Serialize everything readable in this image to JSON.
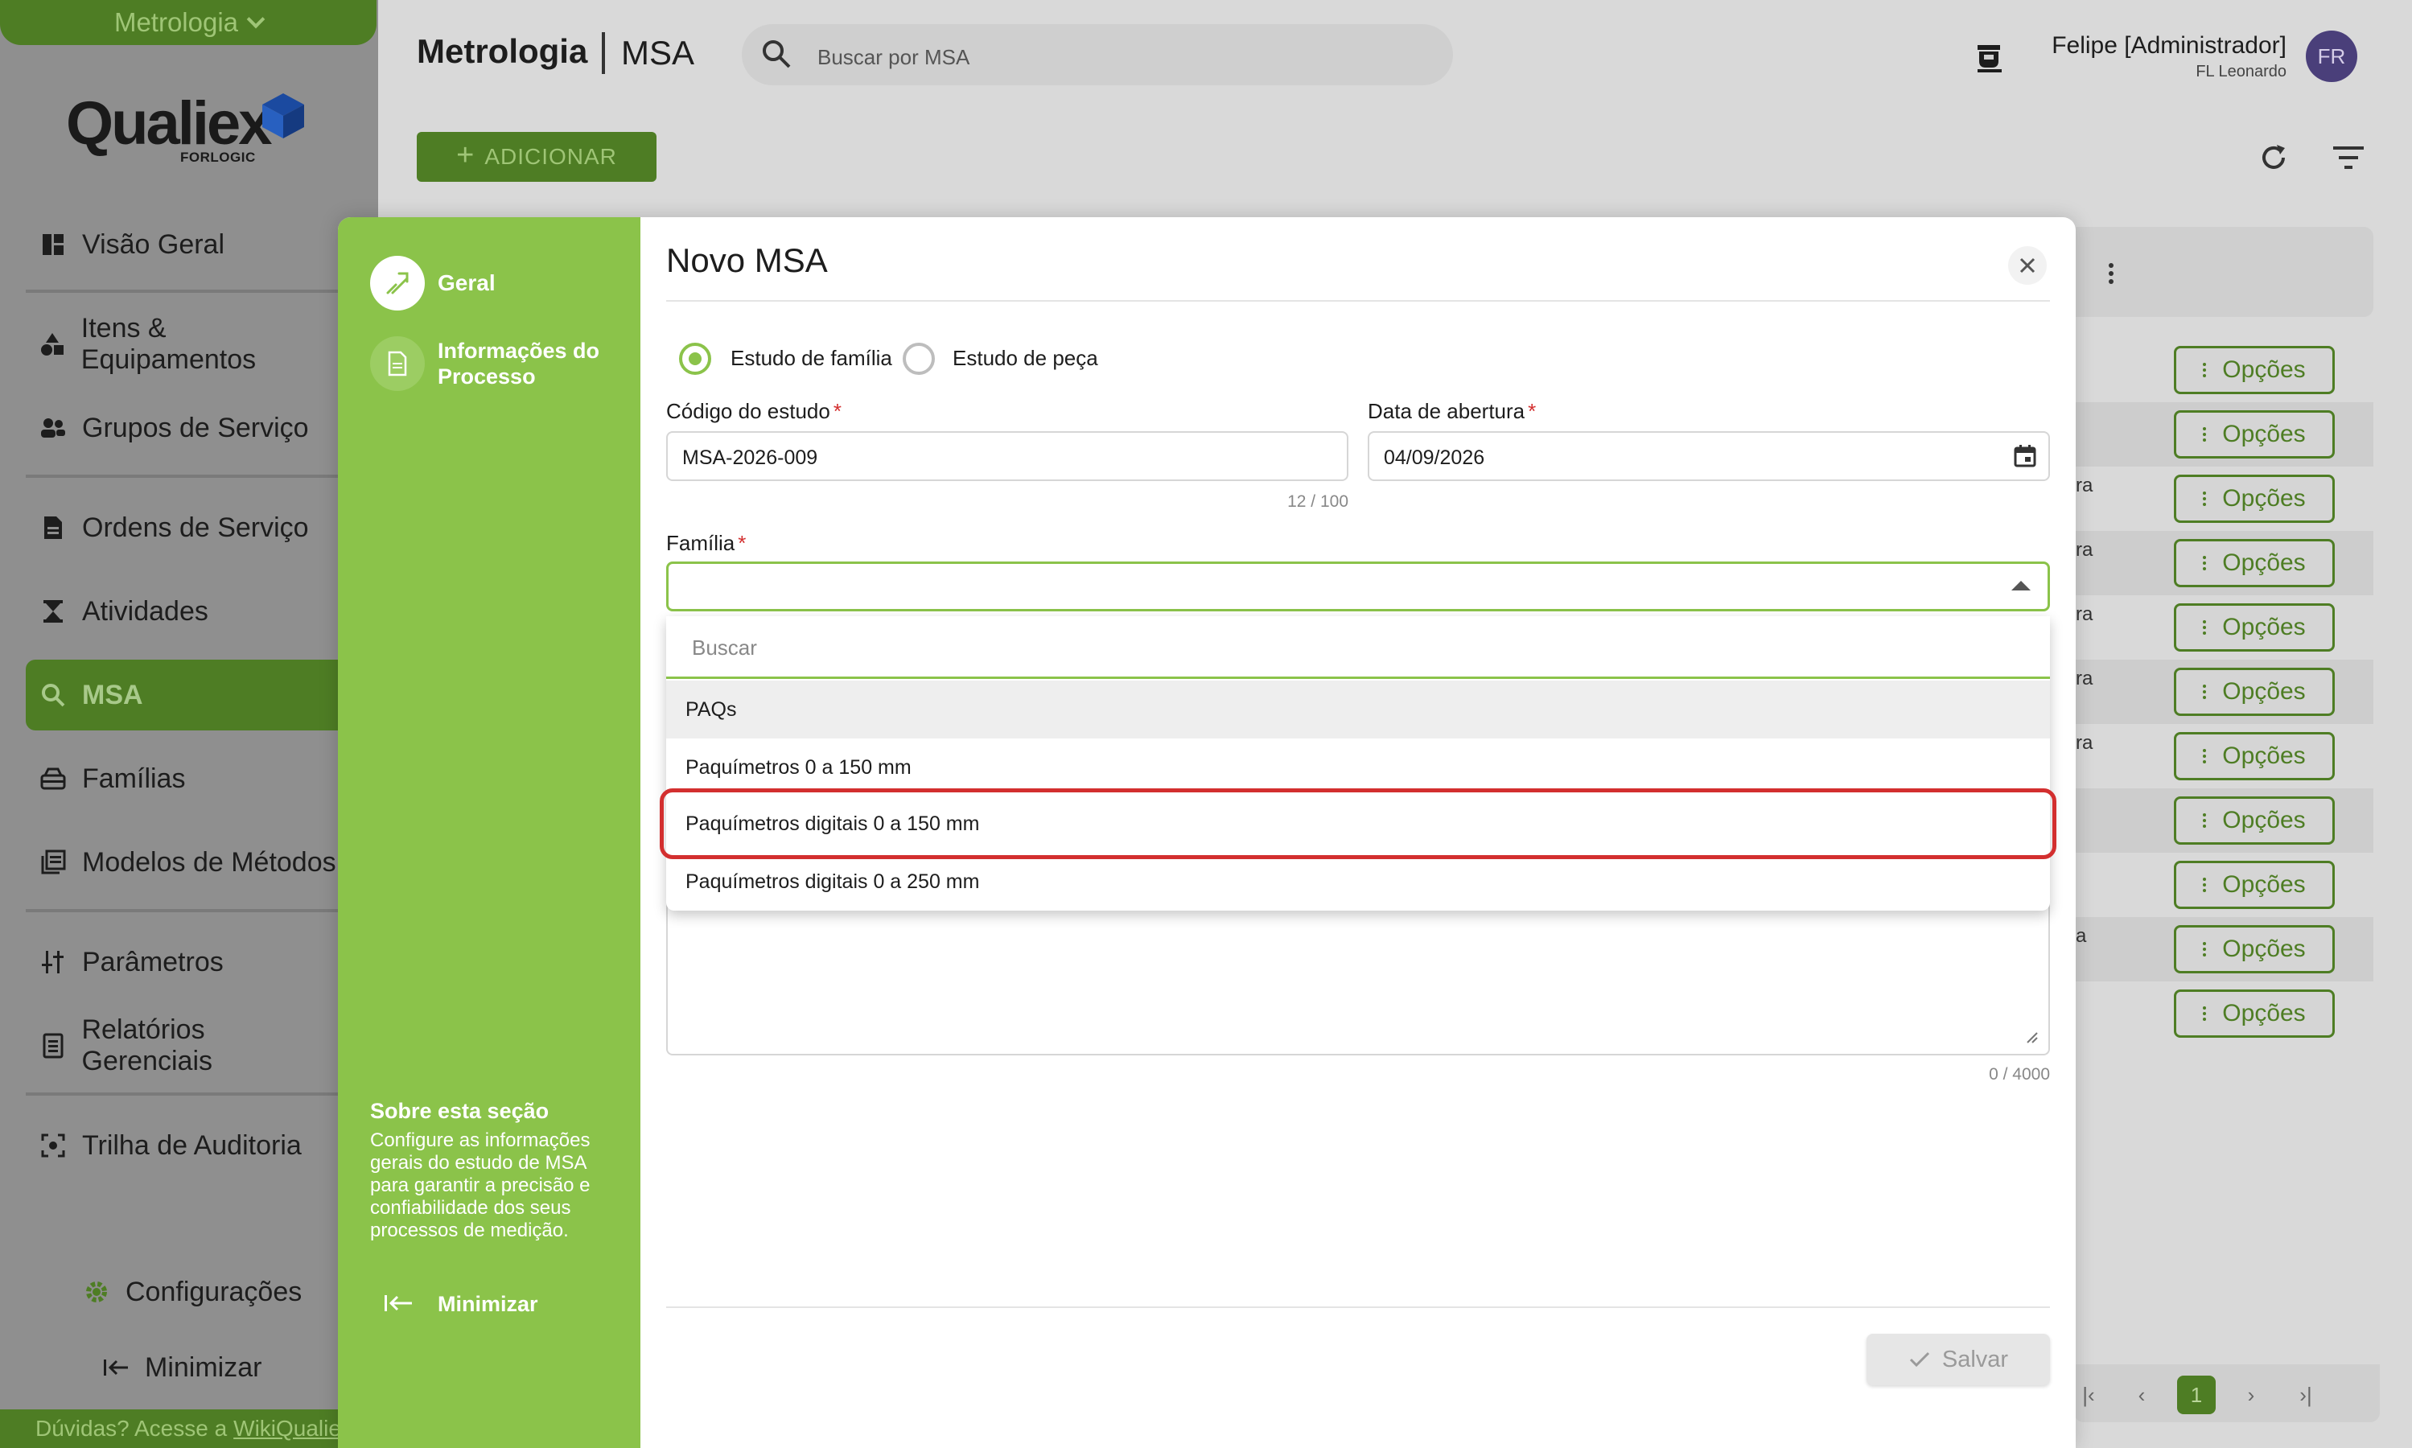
{
  "sidebar": {
    "app_switcher": "Metrologia",
    "logo_text": "Qualiex",
    "logo_sub": "FORLOGIC",
    "items": [
      {
        "label": "Visão Geral",
        "icon": "dashboard-icon"
      },
      {
        "label": "Itens & Equipamentos",
        "icon": "shapes-icon"
      },
      {
        "label": "Grupos de Serviço",
        "icon": "group-icon"
      },
      {
        "label": "Ordens de Serviço",
        "icon": "document-icon"
      },
      {
        "label": "Atividades",
        "icon": "hourglass-icon"
      },
      {
        "label": "MSA",
        "icon": "magnifier-icon"
      },
      {
        "label": "Famílias",
        "icon": "inbox-icon"
      },
      {
        "label": "Modelos de Métodos",
        "icon": "library-icon"
      },
      {
        "label": "Parâmetros",
        "icon": "sliders-icon"
      },
      {
        "label": "Relatórios Gerenciais",
        "icon": "report-icon"
      },
      {
        "label": "Trilha de Auditoria",
        "icon": "audit-icon"
      }
    ],
    "settings_label": "Configurações",
    "minimize_label": "Minimizar",
    "help_text": "Dúvidas? Acesse a",
    "help_link": "WikiQualiex"
  },
  "header": {
    "app": "Metrologia",
    "page": "MSA",
    "search_placeholder": "Buscar por MSA",
    "user_name": "Felipe [Administrador]",
    "user_sub": "FL Leonardo",
    "avatar_initials": "FR"
  },
  "toolbar": {
    "add_label": "ADICIONAR"
  },
  "background_table": {
    "options_label": "Opções",
    "row_fragments": [
      "",
      "",
      "ra",
      "ra",
      "ra",
      "ra",
      "ra",
      "",
      "",
      "a",
      ""
    ],
    "current_page": "1"
  },
  "modal": {
    "title": "Novo MSA",
    "steps": [
      {
        "label": "Geral"
      },
      {
        "label": "Informações do Processo"
      }
    ],
    "about_title": "Sobre esta seção",
    "about_text": "Configure as informações gerais do estudo de MSA para garantir a precisão e confiabilidade dos seus processos de medição.",
    "minimize_label": "Minimizar",
    "radio_family": "Estudo de família",
    "radio_piece": "Estudo de peça",
    "code_label": "Código do estudo",
    "code_value": "MSA-2026-009",
    "code_counter": "12 / 100",
    "date_label": "Data de abertura",
    "date_value": "04/09/2026",
    "family_label": "Família",
    "required_mark": "*",
    "desc_counter": "0 / 4000",
    "save_label": "Salvar",
    "dropdown": {
      "search_placeholder": "Buscar",
      "options": [
        "PAQs",
        "Paquímetros 0 a 150 mm",
        "Paquímetros digitais 0 a 150 mm",
        "Paquímetros digitais 0 a 250 mm"
      ]
    }
  },
  "colors": {
    "brand_green": "#8bc34a",
    "dark_green": "#4e7d24",
    "highlight_red": "#d32f2f",
    "avatar": "#4a3f7a"
  }
}
